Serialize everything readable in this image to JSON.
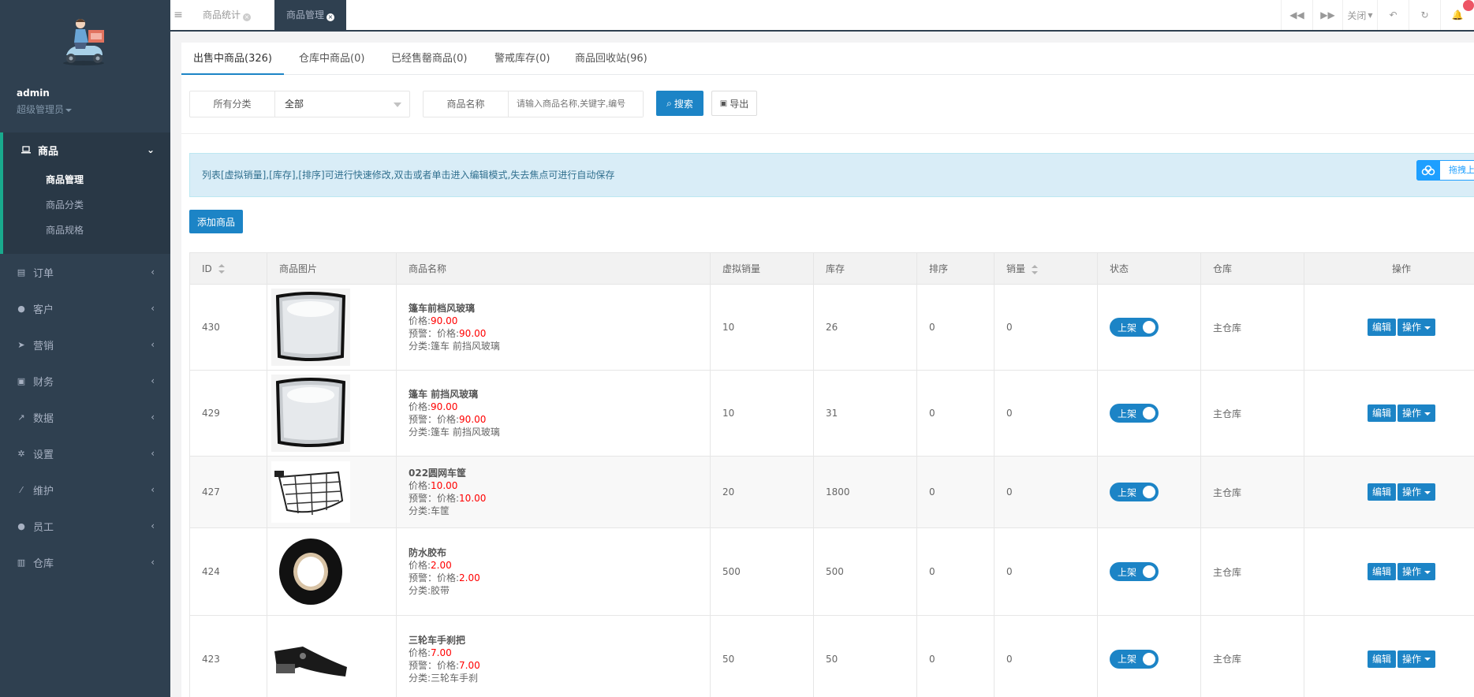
{
  "user": {
    "name": "admin",
    "role": "超级管理员"
  },
  "sidebar": {
    "open_group": {
      "label": "商品",
      "items": [
        {
          "label": "商品管理",
          "active": true
        },
        {
          "label": "商品分类",
          "active": false
        },
        {
          "label": "商品规格",
          "active": false
        }
      ]
    },
    "groups": [
      {
        "label": "订单",
        "icon": "document-icon"
      },
      {
        "label": "客户",
        "icon": "user-icon"
      },
      {
        "label": "营销",
        "icon": "paper-plane-icon"
      },
      {
        "label": "财务",
        "icon": "money-icon"
      },
      {
        "label": "数据",
        "icon": "line-chart-icon"
      },
      {
        "label": "设置",
        "icon": "gear-icon"
      },
      {
        "label": "维护",
        "icon": "magic-wand-icon"
      },
      {
        "label": "员工",
        "icon": "users-icon"
      },
      {
        "label": "仓库",
        "icon": "archive-icon"
      }
    ]
  },
  "page_tabs": [
    {
      "label": "商品统计",
      "active": false
    },
    {
      "label": "商品管理",
      "active": true
    }
  ],
  "top_controls": {
    "close_label": "关闭"
  },
  "tabs": [
    {
      "label": "出售中商品(326)",
      "active": true
    },
    {
      "label": "仓库中商品(0)",
      "active": false
    },
    {
      "label": "已经售罄商品(0)",
      "active": false
    },
    {
      "label": "警戒库存(0)",
      "active": false
    },
    {
      "label": "商品回收站(96)",
      "active": false
    }
  ],
  "search": {
    "category_label": "所有分类",
    "category_value": "全部",
    "name_label": "商品名称",
    "name_placeholder": "请输入商品名称,关键字,编号",
    "search_button": "搜索",
    "export_button": "导出"
  },
  "notice": "列表[虚拟销量],[库存],[排序]可进行快速修改,双击或者单击进入编辑模式,失去焦点可进行自动保存",
  "upload_button": "拖拽上传",
  "add_button": "添加商品",
  "table": {
    "headers": {
      "id": "ID",
      "image": "商品图片",
      "name": "商品名称",
      "virtual_sales": "虚拟销量",
      "stock": "库存",
      "sort": "排序",
      "sales": "销量",
      "status": "状态",
      "warehouse": "仓库",
      "actions": "操作"
    },
    "price_label": "价格:",
    "warn_label": "预警：价格:",
    "category_label": "分类:",
    "status_label": "上架",
    "edit_label": "编辑",
    "ops_label": "操作",
    "rows": [
      {
        "id": "430",
        "name": "篷车前档风玻璃",
        "price": "90.00",
        "warn_price": "90.00",
        "category": "篷车 前挡风玻璃",
        "virtual_sales": "10",
        "stock": "26",
        "sort": "0",
        "sales": "0",
        "warehouse": "主仓库",
        "image": "windshield"
      },
      {
        "id": "429",
        "name": "篷车 前挡风玻璃",
        "price": "90.00",
        "warn_price": "90.00",
        "category": "篷车 前挡风玻璃",
        "virtual_sales": "10",
        "stock": "31",
        "sort": "0",
        "sales": "0",
        "warehouse": "主仓库",
        "image": "windshield"
      },
      {
        "id": "427",
        "name": "022圆网车筐",
        "price": "10.00",
        "warn_price": "10.00",
        "category": "车筐",
        "virtual_sales": "20",
        "stock": "1800",
        "sort": "0",
        "sales": "0",
        "warehouse": "主仓库",
        "image": "basket"
      },
      {
        "id": "424",
        "name": "防水胶布",
        "price": "2.00",
        "warn_price": "2.00",
        "category": "胶带",
        "virtual_sales": "500",
        "stock": "500",
        "sort": "0",
        "sales": "0",
        "warehouse": "主仓库",
        "image": "tape"
      },
      {
        "id": "423",
        "name": "三轮车手刹把",
        "price": "7.00",
        "warn_price": "7.00",
        "category": "三轮车手刹",
        "virtual_sales": "50",
        "stock": "50",
        "sort": "0",
        "sales": "0",
        "warehouse": "主仓库",
        "image": "handbrake"
      }
    ]
  },
  "colors": {
    "sidebar_bg": "#2f4050",
    "accent": "#1c84c6",
    "price_red": "#ff0000"
  }
}
